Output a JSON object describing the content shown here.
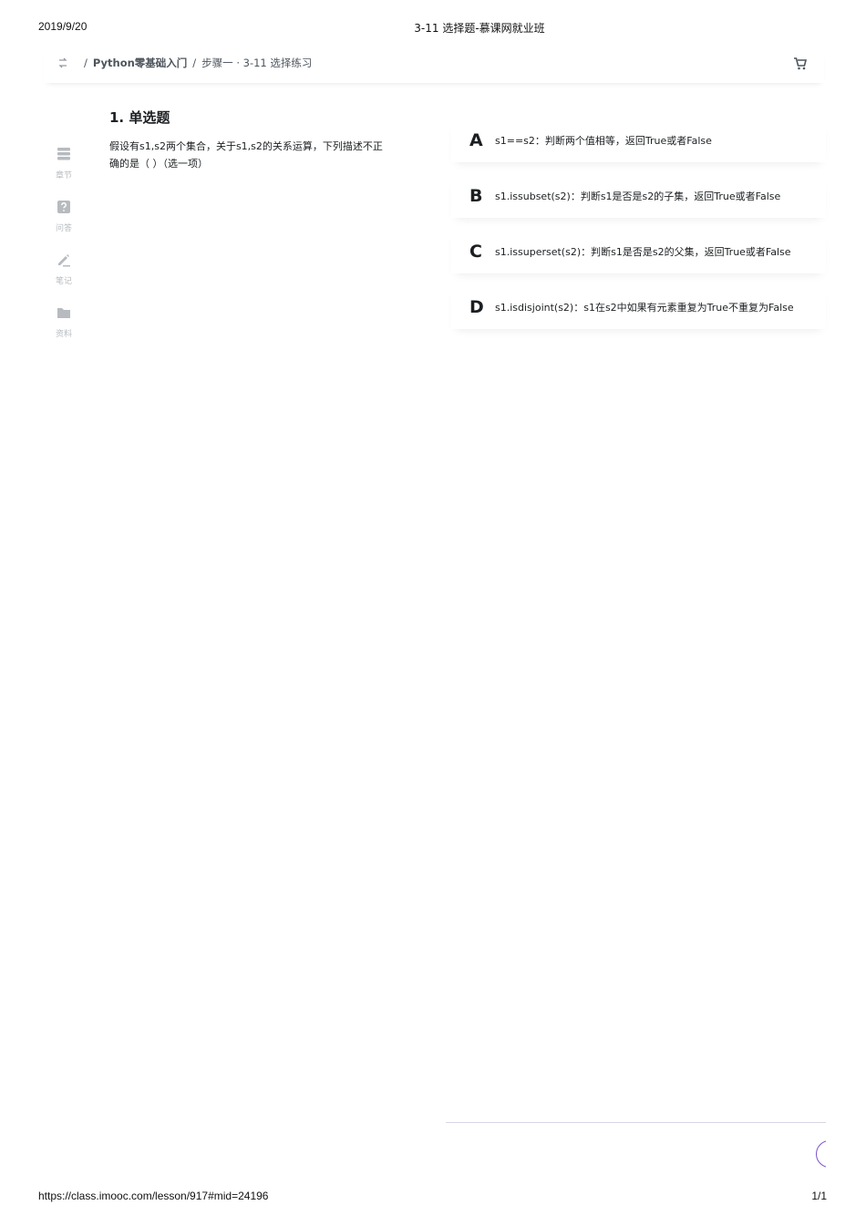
{
  "print": {
    "date": "2019/9/20",
    "title": "3-11 选择题-慕课网就业班",
    "url": "https://class.imooc.com/lesson/917#mid=24196",
    "page": "1/1"
  },
  "breadcrumb": {
    "separator": "/",
    "course": "Python零基础入门",
    "lesson": "步骤一 · 3-11 选择练习"
  },
  "sidenav": [
    {
      "label": "章节",
      "icon": "chapter-icon"
    },
    {
      "label": "问答",
      "icon": "question-icon"
    },
    {
      "label": "笔记",
      "icon": "note-icon"
    },
    {
      "label": "资料",
      "icon": "folder-icon"
    }
  ],
  "question": {
    "title": "1. 单选题",
    "text": "假设有s1,s2两个集合，关于s1,s2的关系运算，下列描述不正确的是（  ）（选一项）"
  },
  "options": [
    {
      "letter": "A",
      "text": "s1==s2：判断两个值相等，返回True或者False"
    },
    {
      "letter": "B",
      "text": "s1.issubset(s2)：判断s1是否是s2的子集，返回True或者False"
    },
    {
      "letter": "C",
      "text": "s1.issuperset(s2)：判断s1是否是s2的父集，返回True或者False"
    },
    {
      "letter": "D",
      "text": "s1.isdisjoint(s2)：s1在s2中如果有元素重复为True不重复为False"
    }
  ],
  "colors": {
    "accent": "#7b52c9",
    "nav_icon": "#b7bbbf",
    "text": "#1c1f21"
  }
}
